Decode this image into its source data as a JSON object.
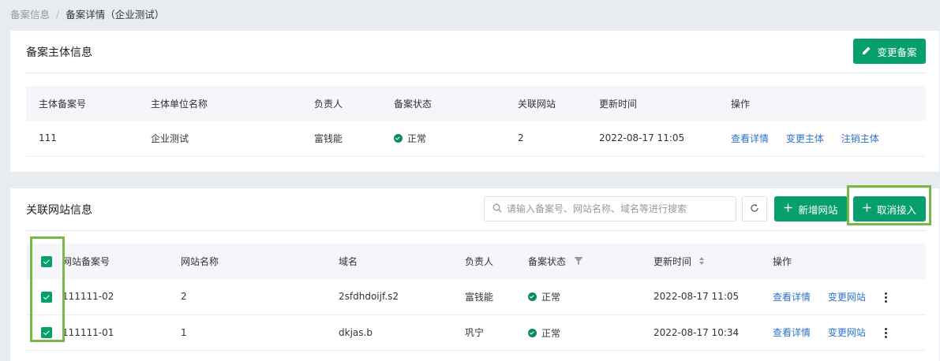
{
  "breadcrumb": {
    "parent": "备案信息",
    "separator": "/",
    "current": "备案详情（企业测试）"
  },
  "subject_card": {
    "title": "备案主体信息",
    "edit_button": "变更备案",
    "columns": [
      "主体备案号",
      "主体单位名称",
      "负责人",
      "备案状态",
      "关联网站",
      "更新时间",
      "操作"
    ],
    "rows": [
      {
        "id": "111",
        "name": "企业测试",
        "owner": "富钱能",
        "status": "正常",
        "sites": "2",
        "updated": "2022-08-17 11:05",
        "actions": [
          "查看详情",
          "变更主体",
          "注销主体"
        ]
      }
    ]
  },
  "site_card": {
    "title": "关联网站信息",
    "search_placeholder": "请输入备案号、网站名称、域名等进行搜索",
    "add_button": "新增网站",
    "cancel_button": "取消接入",
    "columns": [
      "网站备案号",
      "网站名称",
      "域名",
      "负责人",
      "备案状态",
      "更新时间",
      "操作"
    ],
    "rows": [
      {
        "checked": true,
        "id": "111111-02",
        "name": "2",
        "domain": "2sfdhdoijf.s2",
        "owner": "富钱能",
        "status": "正常",
        "updated": "2022-08-17 11:05",
        "actions": [
          "查看详情",
          "变更网站"
        ]
      },
      {
        "checked": true,
        "id": "111111-01",
        "name": "1",
        "domain": "dkjas.b",
        "owner": "巩宁",
        "status": "正常",
        "updated": "2022-08-17 10:34",
        "actions": [
          "查看详情",
          "变更网站"
        ]
      }
    ]
  },
  "colors": {
    "primary": "#07a06c",
    "link": "#2e73c8",
    "highlight": "#76b945",
    "status_ok": "#0b8a5a"
  }
}
